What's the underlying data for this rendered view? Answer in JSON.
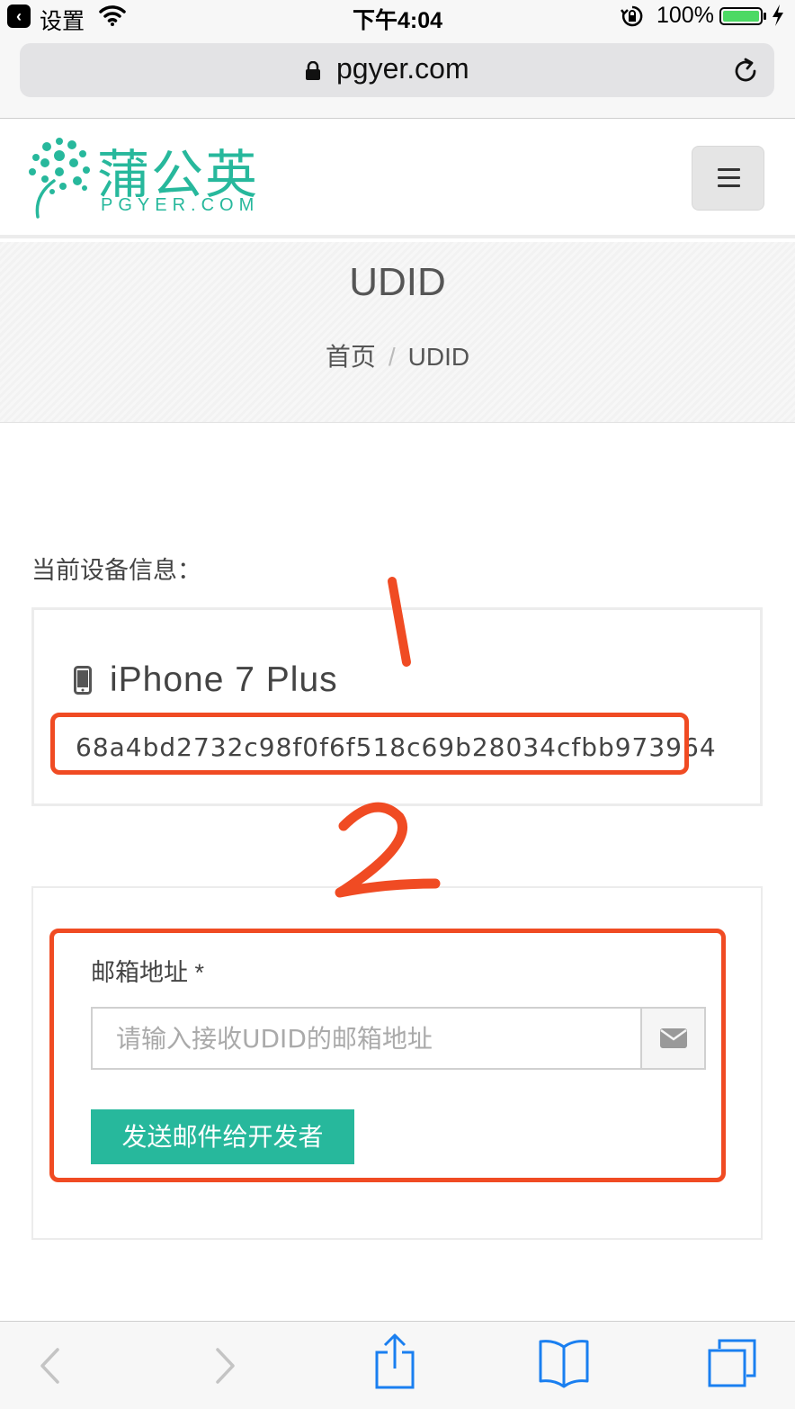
{
  "status_bar": {
    "back_label": "设置",
    "time": "下午4:04",
    "battery_percent": "100%",
    "battery_level": 1.0,
    "battery_color": "#4cd964"
  },
  "browser": {
    "url": "pgyer.com"
  },
  "site": {
    "logo_cn": "蒲公英",
    "logo_en": "PGYER.COM",
    "brand_color": "#27b89c"
  },
  "banner": {
    "title": "UDID",
    "breadcrumb": {
      "home": "首页",
      "separator": "/",
      "current": "UDID"
    }
  },
  "device_info": {
    "label": "当前设备信息：",
    "device_name": "iPhone 7 Plus",
    "udid": "68a4bd2732c98f0f6f518c69b28034cfbb973964"
  },
  "email_form": {
    "label": "邮箱地址 *",
    "placeholder": "请输入接收UDID的邮箱地址",
    "value": "",
    "submit_label": "发送邮件给开发者"
  },
  "annotations": {
    "color": "#f04b23",
    "markers": [
      "1",
      "2"
    ]
  },
  "toolbar": {
    "icons": [
      "back-icon",
      "forward-icon",
      "share-icon",
      "bookmarks-icon",
      "tabs-icon"
    ]
  }
}
